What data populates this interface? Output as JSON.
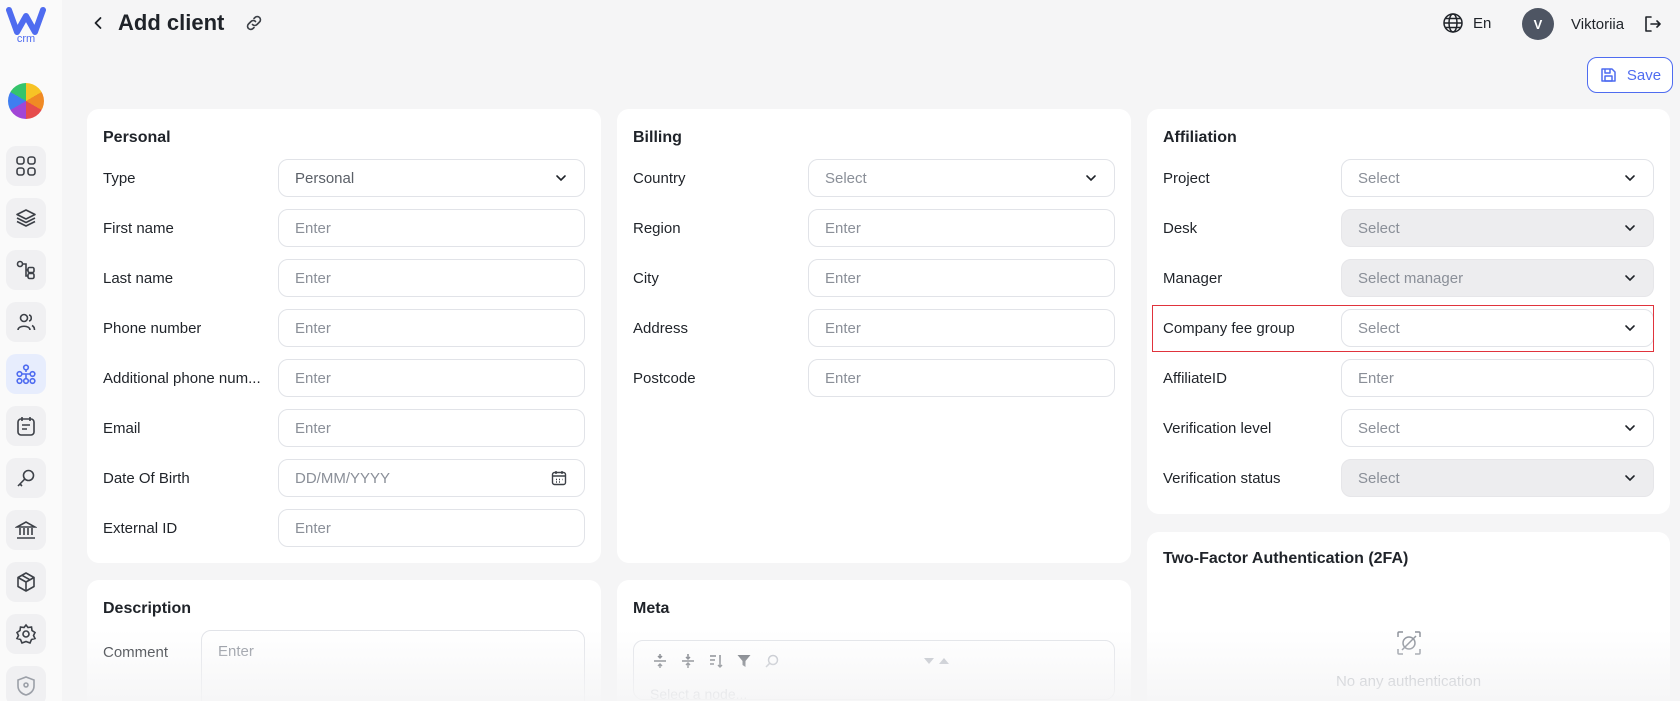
{
  "app": {
    "logo_letter": "W",
    "logo_sub": "crm"
  },
  "header": {
    "title": "Add client",
    "language": "En",
    "avatar_initial": "V",
    "user_name": "Viktoriia",
    "save_label": "Save"
  },
  "sidebar": {
    "items": [
      {
        "icon": "dashboard-icon"
      },
      {
        "icon": "layers-icon"
      },
      {
        "icon": "hierarchy-icon"
      },
      {
        "icon": "users-icon"
      },
      {
        "icon": "network-icon",
        "active": true
      },
      {
        "icon": "notes-icon"
      },
      {
        "icon": "key-icon"
      },
      {
        "icon": "bank-icon"
      },
      {
        "icon": "box-icon"
      },
      {
        "icon": "settings-icon"
      },
      {
        "icon": "shield-icon"
      }
    ]
  },
  "personal": {
    "title": "Personal",
    "fields": [
      {
        "label": "Type",
        "value": "Personal",
        "kind": "select"
      },
      {
        "label": "First name",
        "value": "Enter",
        "kind": "input"
      },
      {
        "label": "Last name",
        "value": "Enter",
        "kind": "input"
      },
      {
        "label": "Phone number",
        "value": "Enter",
        "kind": "input"
      },
      {
        "label": "Additional phone num...",
        "value": "Enter",
        "kind": "input"
      },
      {
        "label": "Email",
        "value": "Enter",
        "kind": "input"
      },
      {
        "label": "Date Of Birth",
        "value": "DD/MM/YYYY",
        "kind": "date"
      },
      {
        "label": "External ID",
        "value": "Enter",
        "kind": "input"
      }
    ]
  },
  "billing": {
    "title": "Billing",
    "fields": [
      {
        "label": "Country",
        "value": "Select",
        "kind": "select"
      },
      {
        "label": "Region",
        "value": "Enter",
        "kind": "input"
      },
      {
        "label": "City",
        "value": "Enter",
        "kind": "input"
      },
      {
        "label": "Address",
        "value": "Enter",
        "kind": "input"
      },
      {
        "label": "Postcode",
        "value": "Enter",
        "kind": "input"
      }
    ]
  },
  "affiliation": {
    "title": "Affiliation",
    "fields": [
      {
        "label": "Project",
        "value": "Select",
        "kind": "select"
      },
      {
        "label": "Desk",
        "value": "Select",
        "kind": "select",
        "disabled": true
      },
      {
        "label": "Manager",
        "value": "Select manager",
        "kind": "select",
        "disabled": true
      },
      {
        "label": "Company fee group",
        "value": "Select",
        "kind": "select",
        "highlighted": true
      },
      {
        "label": "AffiliateID",
        "value": "Enter",
        "kind": "input"
      },
      {
        "label": "Verification level",
        "value": "Select",
        "kind": "select"
      },
      {
        "label": "Verification status",
        "value": "Select",
        "kind": "select",
        "disabled": true
      }
    ]
  },
  "description": {
    "title": "Description",
    "comment_label": "Comment",
    "comment_placeholder": "Enter"
  },
  "meta": {
    "title": "Meta",
    "placeholder": "Select a node..."
  },
  "tfa": {
    "title": "Two-Factor Authentication (2FA)",
    "empty_text": "No any authentication"
  },
  "colors": {
    "accent": "#4f6cf0",
    "highlight": "#e0333c",
    "disabled": "#ededef"
  }
}
